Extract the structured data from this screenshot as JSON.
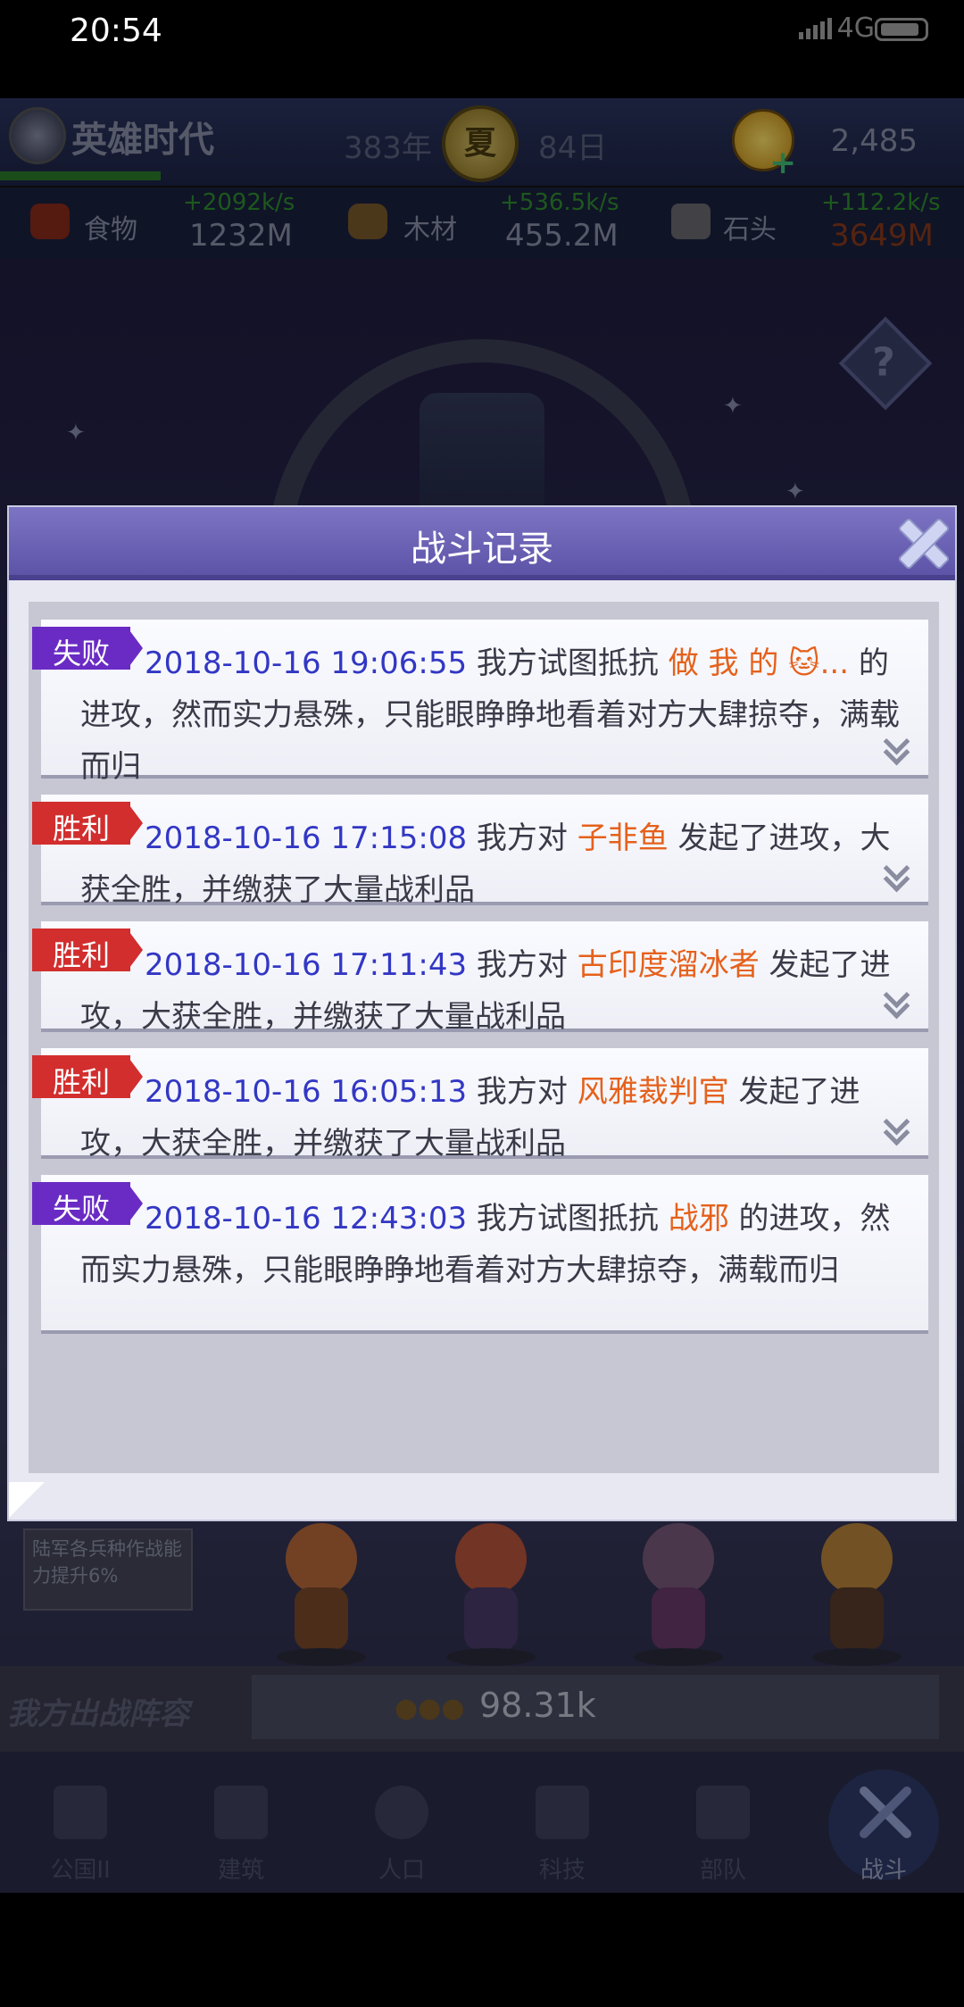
{
  "status_bar": {
    "time": "20:54",
    "network": "4G"
  },
  "header": {
    "title": "英雄时代",
    "year": "383年",
    "season": "夏",
    "day": "84日",
    "gems": "2,485"
  },
  "resources": [
    {
      "name": "食物",
      "rate": "+2092k/s",
      "amount": "1232M"
    },
    {
      "name": "木材",
      "rate": "+536.5k/s",
      "amount": "455.2M"
    },
    {
      "name": "石头",
      "rate": "+112.2k/s",
      "amount": "3649M"
    }
  ],
  "dialog": {
    "title": "战斗记录",
    "records": [
      {
        "result": "失败",
        "time": "2018-10-16 19:06:55",
        "pre": " 我方试图抵抗 ",
        "name": "做 我 的 🐱...",
        "post": " 的进攻，然而实力悬殊，只能眼睁睁地看着对方大肆掠夺，满载而归"
      },
      {
        "result": "胜利",
        "time": "2018-10-16 17:15:08",
        "pre": " 我方对 ",
        "name": "子非鱼",
        "post": " 发起了进攻，大获全胜，并缴获了大量战利品"
      },
      {
        "result": "胜利",
        "time": "2018-10-16 17:11:43",
        "pre": " 我方对 ",
        "name": "古印度溜冰者",
        "post": " 发起了进攻，大获全胜，并缴获了大量战利品"
      },
      {
        "result": "胜利",
        "time": "2018-10-16 16:05:13",
        "pre": " 我方对 ",
        "name": "风雅裁判官",
        "post": " 发起了进攻，大获全胜，并缴获了大量战利品"
      },
      {
        "result": "失败",
        "time": "2018-10-16 12:43:03",
        "pre": " 我方试图抵抗 ",
        "name": "战邪",
        "post": " 的进攻，然而实力悬殊，只能眼睁睁地看着对方大肆掠夺，满载而归"
      }
    ]
  },
  "bonus_text": "陆军各兵种作战能力提升6%",
  "lineup": {
    "label": "我方出战阵容",
    "power": "98.31k"
  },
  "nav": [
    {
      "label": "公国II",
      "icon": "castle-icon"
    },
    {
      "label": "建筑",
      "icon": "house-icon"
    },
    {
      "label": "人口",
      "icon": "person-icon"
    },
    {
      "label": "科技",
      "icon": "book-icon"
    },
    {
      "label": "部队",
      "icon": "banner-icon"
    },
    {
      "label": "战斗",
      "icon": "swords-icon"
    }
  ],
  "colors": {
    "win_badge": "#d22e2e",
    "lose_badge": "#6a2bc4",
    "timestamp": "#3237c4",
    "player_name": "#e5611c"
  }
}
